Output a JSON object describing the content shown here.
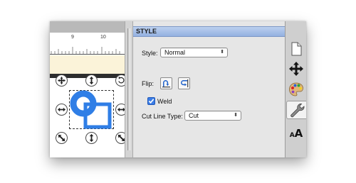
{
  "ruler": {
    "mark_9": "9",
    "mark_10": "10"
  },
  "style_panel": {
    "title": "STYLE",
    "style_label": "Style:",
    "style_value": "Normal",
    "flip_label": "Flip:",
    "weld_label": "Weld",
    "weld_checked": true,
    "cut_line_type_label": "Cut Line Type:",
    "cut_line_type_value": "Cut"
  },
  "toolbar": {
    "items": [
      "document-icon",
      "move-arrows-icon",
      "color-palette-icon",
      "wrench-icon",
      "text-size-icon"
    ],
    "text_size_glyphs": {
      "small": "A",
      "large": "A"
    },
    "active_item": "wrench-icon"
  },
  "colors": {
    "shape_blue": "#2f7ee6",
    "header_blue": "#a9c1ea",
    "checkbox_blue": "#3b7de6"
  }
}
